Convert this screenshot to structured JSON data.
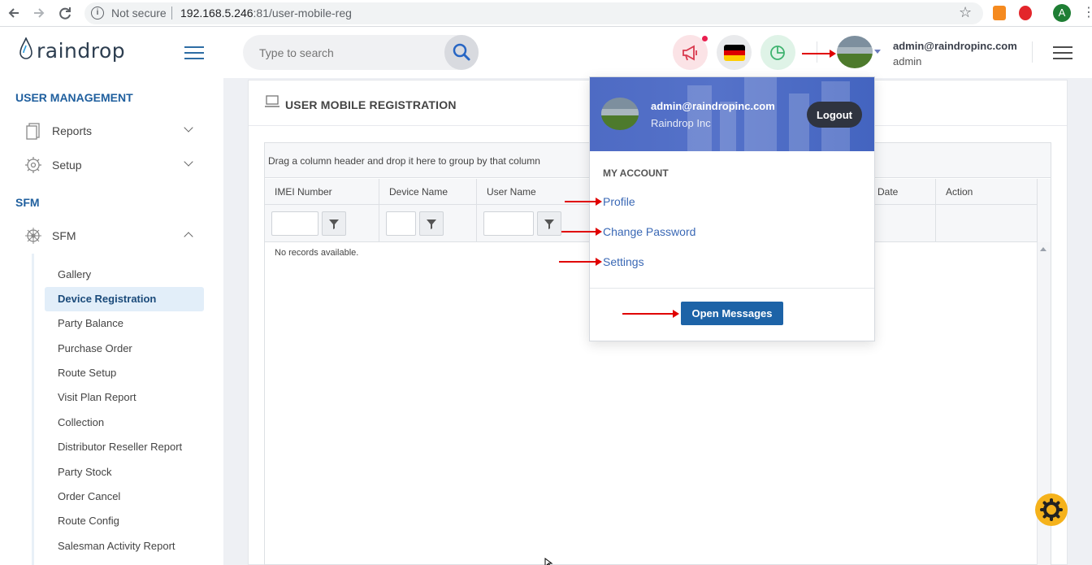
{
  "browser": {
    "security_label": "Not secure",
    "url_host": "192.168.5.246",
    "url_rest": ":81/user-mobile-reg",
    "profile_initial": "A"
  },
  "header": {
    "logo_text": "raindrop",
    "search_placeholder": "Type to search",
    "user_email": "admin@raindropinc.com",
    "user_role": "admin",
    "flag_colors": [
      "#000000",
      "#dd0000",
      "#ffce00"
    ]
  },
  "sidebar": {
    "section_user_management": "USER MANAGEMENT",
    "reports_label": "Reports",
    "setup_label": "Setup",
    "section_sfm": "SFM",
    "sfm_label": "SFM",
    "sub_items": [
      "Gallery",
      "Device Registration",
      "Party Balance",
      "Purchase Order",
      "Route Setup",
      "Visit Plan Report",
      "Collection",
      "Distributor Reseller Report",
      "Party Stock",
      "Order Cancel",
      "Route Config",
      "Salesman Activity Report"
    ],
    "active_item": "Device Registration"
  },
  "page": {
    "title": "USER MOBILE REGISTRATION",
    "group_hint": "Drag a column header and drop it here to group by that column",
    "columns": [
      "IMEI Number",
      "Device Name",
      "User Name",
      "Date",
      "Action"
    ],
    "no_records": "No records available."
  },
  "dropdown": {
    "email": "admin@raindropinc.com",
    "org": "Raindrop Inc",
    "logout_label": "Logout",
    "section_label": "MY ACCOUNT",
    "links": [
      "Profile",
      "Change Password",
      "Settings"
    ],
    "open_messages_label": "Open Messages"
  },
  "colors": {
    "accent": "#1f5f9e",
    "dropdown_header": "#4e6bc4",
    "annotation_arrow": "#e00000",
    "fab": "#f5b21b"
  }
}
